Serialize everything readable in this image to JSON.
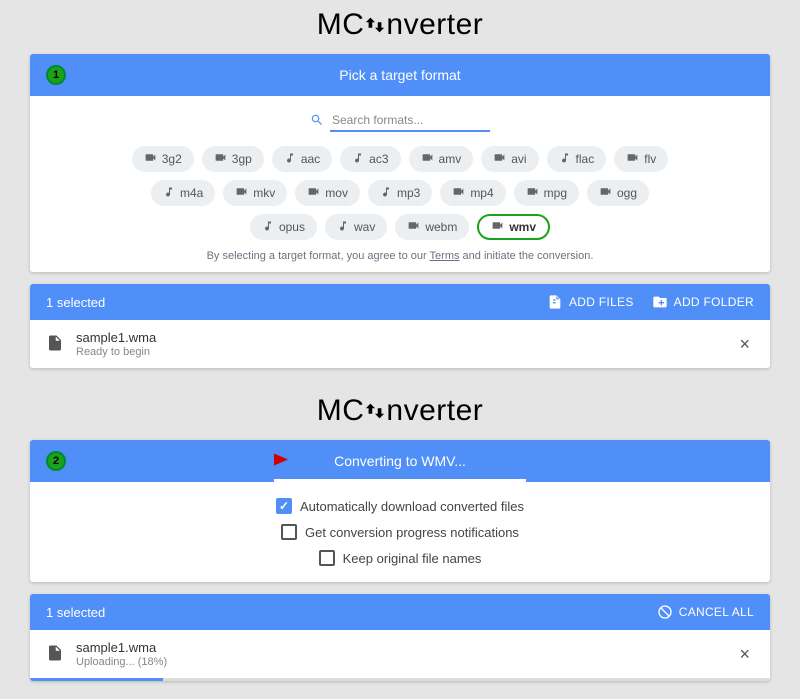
{
  "logo_prefix": "MC",
  "logo_suffix": "nverter",
  "step1": {
    "badge": "1",
    "title": "Pick a target format",
    "search_placeholder": "Search formats...",
    "formats": [
      {
        "label": "3g2",
        "icon": "video"
      },
      {
        "label": "3gp",
        "icon": "video"
      },
      {
        "label": "aac",
        "icon": "audio"
      },
      {
        "label": "ac3",
        "icon": "audio"
      },
      {
        "label": "amv",
        "icon": "video"
      },
      {
        "label": "avi",
        "icon": "video"
      },
      {
        "label": "flac",
        "icon": "audio"
      },
      {
        "label": "flv",
        "icon": "video"
      },
      {
        "label": "m4a",
        "icon": "audio"
      },
      {
        "label": "mkv",
        "icon": "video"
      },
      {
        "label": "mov",
        "icon": "video"
      },
      {
        "label": "mp3",
        "icon": "audio"
      },
      {
        "label": "mp4",
        "icon": "video"
      },
      {
        "label": "mpg",
        "icon": "video"
      },
      {
        "label": "ogg",
        "icon": "video"
      },
      {
        "label": "opus",
        "icon": "audio"
      },
      {
        "label": "wav",
        "icon": "audio"
      },
      {
        "label": "webm",
        "icon": "video"
      },
      {
        "label": "wmv",
        "icon": "video",
        "selected": true
      }
    ],
    "terms_pre": "By selecting a target format, you agree to our ",
    "terms_link": "Terms",
    "terms_post": " and initiate the conversion."
  },
  "listbar1": {
    "selected_text": "1 selected",
    "add_files": "ADD FILES",
    "add_folder": "ADD FOLDER"
  },
  "file1": {
    "name": "sample1.wma",
    "status": "Ready to begin"
  },
  "step2": {
    "badge": "2",
    "title": "Converting to WMV...",
    "options": [
      {
        "label": "Automatically download converted files",
        "checked": true
      },
      {
        "label": "Get conversion progress notifications",
        "checked": false
      },
      {
        "label": "Keep original file names",
        "checked": false
      }
    ]
  },
  "listbar2": {
    "selected_text": "1 selected",
    "cancel_all": "CANCEL ALL"
  },
  "file2": {
    "name": "sample1.wma",
    "status": "Uploading... (18%)",
    "progress_pct": 18
  }
}
